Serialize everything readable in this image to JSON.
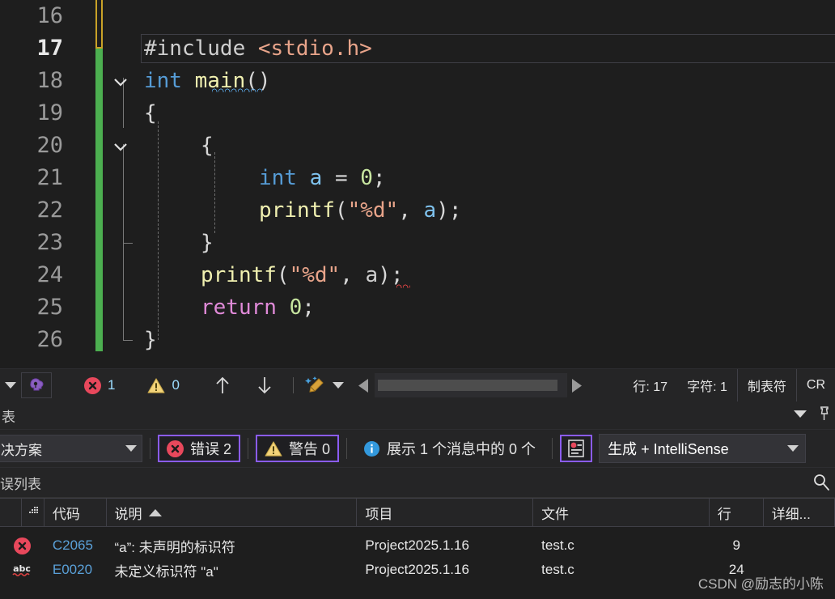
{
  "editor": {
    "lines": [
      {
        "num": "16",
        "current": false,
        "tokens": []
      },
      {
        "num": "17",
        "current": true,
        "text": "#include <stdio.h>"
      },
      {
        "num": "18",
        "current": false,
        "text": "int main()"
      },
      {
        "num": "19",
        "current": false,
        "text": "{"
      },
      {
        "num": "20",
        "current": false,
        "text": "    {"
      },
      {
        "num": "21",
        "current": false,
        "text": "        int a = 0;"
      },
      {
        "num": "22",
        "current": false,
        "text": "        printf(\"%d\", a);"
      },
      {
        "num": "23",
        "current": false,
        "text": "    }"
      },
      {
        "num": "24",
        "current": false,
        "text": "    printf(\"%d\", a);"
      },
      {
        "num": "25",
        "current": false,
        "text": "    return 0;"
      },
      {
        "num": "26",
        "current": false,
        "text": "}"
      }
    ],
    "line_numbers": [
      "16",
      "17",
      "18",
      "19",
      "20",
      "21",
      "22",
      "23",
      "24",
      "25",
      "26"
    ],
    "code": {
      "l17_include": "#include",
      "l17_header": "<stdio.h>",
      "l18_int": "int",
      "l18_main": "main",
      "l18_parens": "()",
      "l19_brace": "{",
      "l20_brace": "{",
      "l21_int": "int",
      "l21_a": "a",
      "l21_eq": "=",
      "l21_zero": "0",
      "l21_semi": ";",
      "l22_printf": "printf",
      "l22_open": "(",
      "l22_str": "\"%d\"",
      "l22_comma": ", ",
      "l22_a": "a",
      "l22_close": ");",
      "l23_brace": "}",
      "l24_printf": "printf",
      "l24_open": "(",
      "l24_str": "\"%d\"",
      "l24_comma": ", ",
      "l24_a": "a",
      "l24_close": ");",
      "l25_return": "return",
      "l25_zero": "0",
      "l25_semi": ";",
      "l26_brace": "}"
    },
    "colors": {
      "background": "#1e1e1e",
      "line_number": "#9a9a9a",
      "keyword": "#569cd6",
      "control_keyword": "#e08ad8",
      "function": "#f0f0b0",
      "string": "#e8a48a",
      "number": "#c8e6a0",
      "variable": "#7fc3ef",
      "change_bar_saved": "#4caf50",
      "change_bar_unsaved": "#c9a227",
      "squiggle_blue": "#569cd6",
      "squiggle_red": "#e04343"
    }
  },
  "status_bar": {
    "intellisense_icon": "intellisense-brain-icon",
    "error_icon": "error-circle-icon",
    "error_count": "1",
    "warning_icon": "warning-triangle-icon",
    "warning_count": "0",
    "prev_icon": "arrow-up-icon",
    "next_icon": "arrow-down-icon",
    "cleanup_icon": "code-cleanup-broom-icon",
    "line_label": "行: 17",
    "char_label": "字符: 1",
    "tab_label": "制表符",
    "eol_label": "CR"
  },
  "panel": {
    "title": "表",
    "dropdown_icon": "chevron-down-icon",
    "pin_icon": "pin-icon",
    "toolbar": {
      "scope_value": "决方案",
      "scope_caret": "chevron-down-icon",
      "errors_label": "错误 2",
      "warnings_label": "警告 0",
      "messages_label": "展示 1 个消息中的 0 个",
      "filter_icon": "error-filter-icon",
      "build_value": "生成 + IntelliSense",
      "build_caret": "chevron-down-icon",
      "focus_outline_color": "#8b5cf6"
    },
    "search": {
      "text": "误列表",
      "icon": "search-magnifier-icon"
    },
    "table": {
      "headers": [
        "",
        "代码",
        "说明",
        "项目",
        "文件",
        "行",
        "详细..."
      ],
      "sort_column": "说明",
      "sort_icon": "sort-ascending-icon",
      "column_chooser_icon": "column-chooser-icon",
      "rows": [
        {
          "severity_icon": "error-circle-icon",
          "code": "C2065",
          "description": "“a”: 未声明的标识符",
          "project": "Project2025.1.16",
          "file": "test.c",
          "line": "9",
          "details": ""
        },
        {
          "severity_icon": "abc-spellcheck-icon",
          "code": "E0020",
          "description": "未定义标识符 \"a\"",
          "project": "Project2025.1.16",
          "file": "test.c",
          "line": "24",
          "details": ""
        }
      ]
    }
  },
  "watermark": "CSDN @励志的小陈"
}
